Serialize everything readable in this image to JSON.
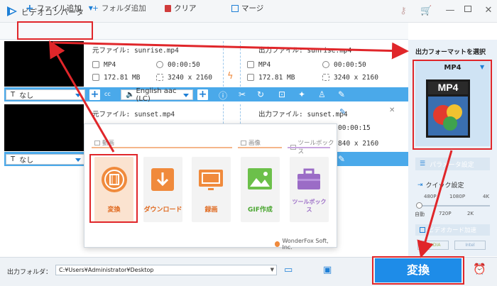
{
  "window": {
    "title": "ビデオコンバータ"
  },
  "toolbar": {
    "add_file": "ファイル追加",
    "add_folder": "フォルダ追加",
    "clear": "クリア",
    "merge": "マージ"
  },
  "files": [
    {
      "source_label": "元ファイル: sunrise.mp4",
      "output_label": "出力ファイル: sunrise.mp4",
      "src_format": "MP4",
      "src_duration": "00:00:50",
      "src_size": "172.81 MB",
      "src_resolution": "3240 x 2160",
      "out_format": "MP4",
      "out_duration": "00:00:50",
      "out_size": "172.81 MB",
      "out_resolution": "3240 x 2160",
      "subtitle": "なし",
      "audio": "English aac (LC)"
    },
    {
      "source_label": "元ファイル: sunset.mp4",
      "output_label": "出力ファイル: sunset.mp4",
      "out_duration": "00:00:15",
      "out_resolution_partial": "840 x 2160",
      "subtitle": "なし"
    }
  ],
  "popup": {
    "categories": {
      "video": "動画",
      "image": "画像",
      "toolbox": "ツールボックス"
    },
    "tiles": [
      "変換",
      "ダウンロード",
      "録画",
      "GIF作成",
      "ツールボックス"
    ],
    "brand": "WonderFox Soft, Inc."
  },
  "right_panel": {
    "format_title": "出力フォーマットを選択",
    "format_value": "MP4",
    "format_icon_text": "MP4",
    "param_settings": "パラメータ設定",
    "quick_settings": "クイック設定",
    "quality_top": [
      "480P",
      "1080P",
      "4K"
    ],
    "quality_bottom": [
      "自動",
      "720P",
      "2K"
    ],
    "gpu_accel": "ビデオカード加速",
    "gpu_vendors": [
      "NVIDIA",
      "Intel"
    ]
  },
  "bottom": {
    "output_folder_label": "出力フォルダ：",
    "output_folder_path": "C:¥Users¥Administrator¥Desktop",
    "convert_button": "変換"
  },
  "colors": {
    "accent": "#1e7fd6",
    "bar": "#4aa9ea",
    "annotation": "#e0262a",
    "orange": "#f08a3c"
  }
}
